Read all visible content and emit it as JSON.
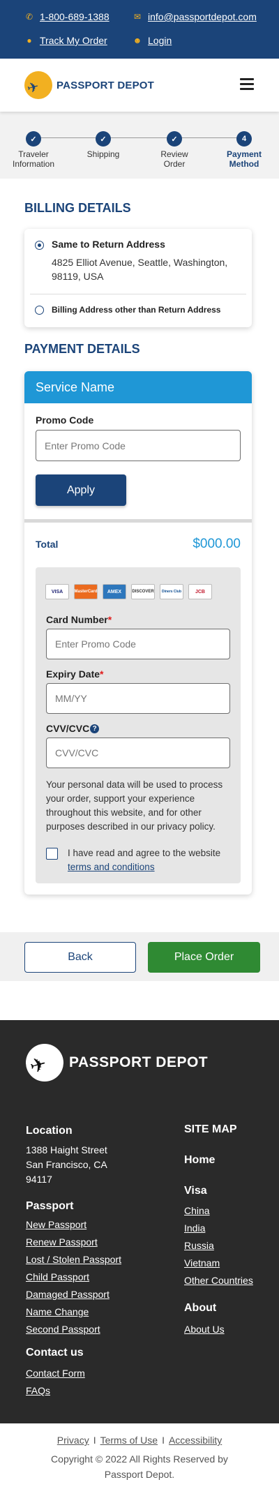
{
  "topbar": {
    "phone": "1-800-689-1388",
    "email": "info@passportdepot.com",
    "track": "Track My Order",
    "login": "Login"
  },
  "header": {
    "brand": "PASSPORT DEPOT"
  },
  "stepper": {
    "steps": [
      {
        "label_line1": "Traveler",
        "label_line2": "Information",
        "icon": "check-icon"
      },
      {
        "label_line1": "Shipping",
        "label_line2": "",
        "icon": "check-icon"
      },
      {
        "label_line1": "Review",
        "label_line2": "Order",
        "icon": "check-icon"
      },
      {
        "number": "4",
        "label_line1": "Payment",
        "label_line2": "Method"
      }
    ]
  },
  "billing": {
    "title": "BILLING DETAILS",
    "option1_label": "Same to Return Address",
    "option1_address_line1": "4825 Elliot Avenue, Seattle, Washington,",
    "option1_address_line2": "98119, USA",
    "option2_label": "Billing Address other than Return Address"
  },
  "payment": {
    "title": "PAYMENT DETAILS",
    "service_name": "Service Name",
    "promo_label": "Promo Code",
    "promo_placeholder": "Enter Promo Code",
    "apply": "Apply",
    "total_label": "Total",
    "total_value": "$000.00",
    "cards": [
      "VISA",
      "MasterCard",
      "AMEX",
      "DISCOVER",
      "Diners Club",
      "JCB"
    ],
    "card_number_label": "Card Number",
    "card_number_placeholder": "Enter Promo Code",
    "expiry_label": "Expiry Date",
    "expiry_placeholder": "MM/YY",
    "cvv_label": "CVV/CVC",
    "cvv_placeholder": "CVV/CVC",
    "privacy_text": "Your personal data will be used to process your order, support your experience throughout this website, and for other purposes described in our privacy policy.",
    "agree_text": "I have read and agree to the website",
    "terms_link": "terms and conditions"
  },
  "actions": {
    "back": "Back",
    "place_order": "Place Order"
  },
  "footer": {
    "brand": "PASSPORT DEPOT",
    "location_title": "Location",
    "address_line1": "1388 Haight Street",
    "address_line2": "San Francisco, CA",
    "address_line3": "94117",
    "passport_title": "Passport",
    "passport_links": [
      "New Passport",
      "Renew Passport",
      "Lost / Stolen Passport",
      "Child Passport",
      "Damaged Passport",
      "Name Change",
      "Second Passport"
    ],
    "contact_title": "Contact us",
    "contact_links": [
      "Contact Form",
      "FAQs"
    ],
    "sitemap_title": "SITE  MAP",
    "home": "Home",
    "visa_title": "Visa",
    "visa_links": [
      "China",
      "India",
      "Russia",
      "Vietnam",
      "Other Countries"
    ],
    "about_title": "About",
    "about_link": "About Us"
  },
  "legal": {
    "privacy": "Privacy",
    "sep": "I",
    "terms": "Terms of Use",
    "accessibility": "Accessibility",
    "copyright_line1": "Copyright © 2022 All Rights Reserved by",
    "copyright_line2": "Passport Depot."
  },
  "colors": {
    "navy": "#1b4479",
    "blue": "#1f97d6",
    "green": "#2f8a33",
    "gold": "#f2b021"
  }
}
